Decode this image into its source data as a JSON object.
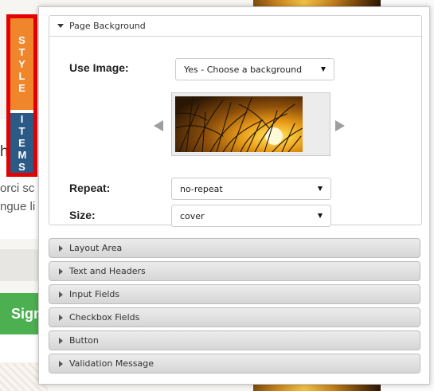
{
  "side_tabs": {
    "style_label": "STYLE",
    "items_label": "ITEMS"
  },
  "background_page": {
    "heading_fragment": "h",
    "text_line_1": "orci sc",
    "text_line_2": "ngue li",
    "button_fragment": "Sign"
  },
  "panel": {
    "page_background": {
      "title": "Page Background",
      "use_image_label": "Use Image:",
      "use_image_value": "Yes - Choose a background",
      "repeat_label": "Repeat:",
      "repeat_value": "no-repeat",
      "size_label": "Size:",
      "size_value": "cover"
    },
    "sections": [
      {
        "label": "Layout Area"
      },
      {
        "label": "Text and Headers"
      },
      {
        "label": "Input Fields"
      },
      {
        "label": "Checkbox Fields"
      },
      {
        "label": "Button"
      },
      {
        "label": "Validation Message"
      }
    ]
  },
  "colors": {
    "style_tab": "#f0862c",
    "items_tab": "#2b5a86",
    "tab_border": "#e60000",
    "bg_button": "#4cb050"
  },
  "icons": {
    "expanded": "caret-down-icon",
    "collapsed": "caret-right-icon",
    "prev": "prev-arrow-icon",
    "next": "next-arrow-icon",
    "dropdown": "dropdown-arrow-icon"
  }
}
